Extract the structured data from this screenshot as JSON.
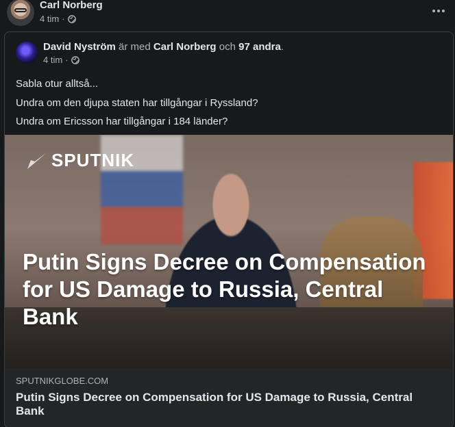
{
  "outer_post": {
    "author": "Carl Norberg",
    "time": "4 tim",
    "separator": "·",
    "privacy_icon": "globe-icon",
    "more_icon": "more-horizontal-icon"
  },
  "shared_post": {
    "author": "David Nyström",
    "with_text": "är med",
    "tagged": "Carl Norberg",
    "and_text": "och",
    "others": "97 andra",
    "period": ".",
    "time": "4 tim",
    "separator": "·",
    "privacy_icon": "globe-icon",
    "lines": [
      "Sabla otur alltså...",
      "Undra om den djupa staten har tillgångar i Ryssland?",
      "Undra om Ericsson har tillgångar i 184 länder?"
    ]
  },
  "link_preview": {
    "brand": "SPUTNIK",
    "image_headline": "Putin Signs Decree on Compensation for US Damage to Russia, Central Bank",
    "domain": "SPUTNIKGLOBE.COM",
    "title": "Putin Signs Decree on Compensation for US Damage to Russia, Central Bank"
  },
  "colors": {
    "background": "#18191a",
    "card_footer": "#242526",
    "primary_text": "#e4e6eb",
    "secondary_text": "#b0b3b8"
  }
}
